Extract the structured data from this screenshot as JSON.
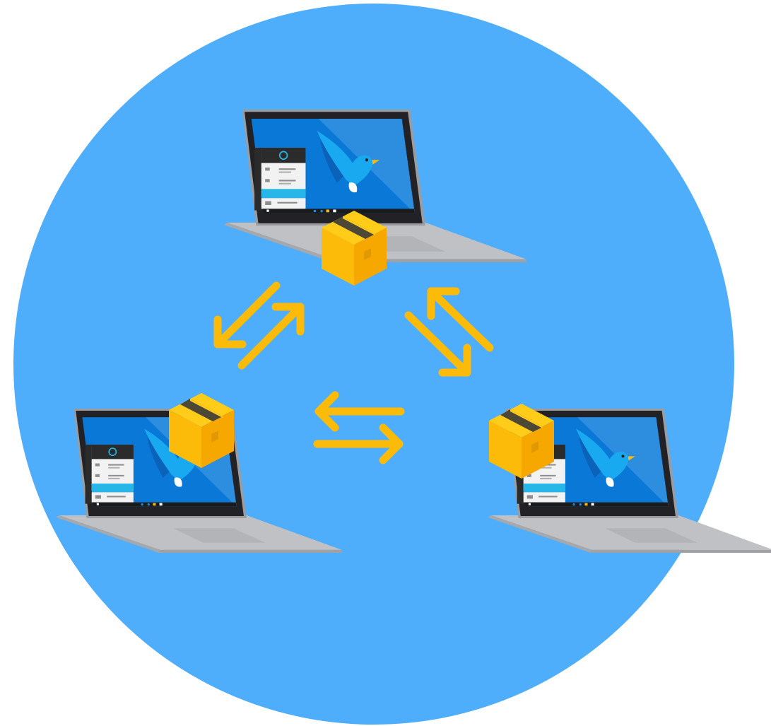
{
  "colors": {
    "background": "#ffffff",
    "circle": "#4eaefc",
    "arrow": "#fcbb08",
    "package_top": "#ffcc1a",
    "package_left": "#fcbb08",
    "package_right": "#f6a800",
    "package_tape": "#3a3a3a",
    "laptop_bezel": "#222226",
    "laptop_frame": "#9a9ca0",
    "laptop_deck": "#bfc1c4",
    "laptop_deck_edge": "#9fa1a4",
    "screen_blue": "#0a78d7",
    "screen_light": "#2d8ee0",
    "bird_light": "#19a9f0",
    "bird_dark": "#0a63b8",
    "taskbar": "#1b1b1b",
    "start_menu_dark": "#2b2b2b",
    "start_menu_light": "#f2f2f2",
    "start_menu_accent": "#26b6e8"
  },
  "icons": {
    "laptop": "laptop-icon",
    "package": "package-icon",
    "arrow": "arrow-icon",
    "bird": "bird-icon"
  }
}
